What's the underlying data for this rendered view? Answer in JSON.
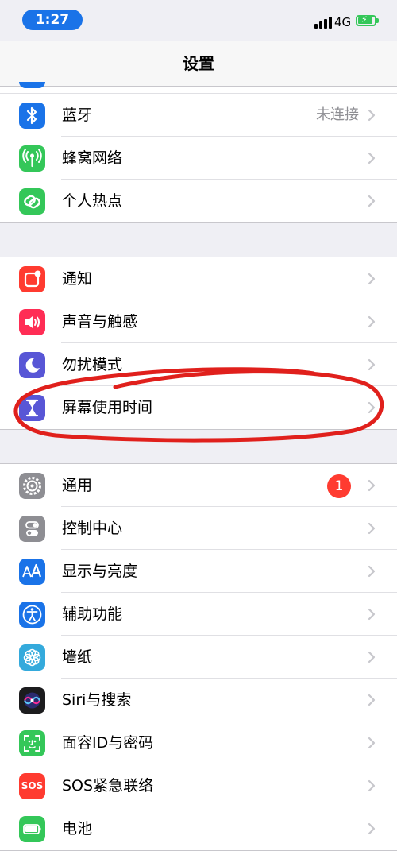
{
  "status_bar": {
    "time": "1:27",
    "network": "4G",
    "signal_bars": 4,
    "battery_charging": true
  },
  "nav": {
    "title": "设置"
  },
  "groups": [
    {
      "rows": [
        {
          "label": "蓝牙",
          "value": "未连接",
          "icon": "bluetooth-icon",
          "color": "#1a73e8"
        },
        {
          "label": "蜂窝网络",
          "icon": "cellular-antenna-icon",
          "color": "#34c759"
        },
        {
          "label": "个人热点",
          "icon": "hotspot-link-icon",
          "color": "#34c759"
        }
      ]
    },
    {
      "rows": [
        {
          "label": "通知",
          "icon": "notification-icon",
          "color": "#ff3b30"
        },
        {
          "label": "声音与触感",
          "icon": "speaker-icon",
          "color": "#ff2d55"
        },
        {
          "label": "勿扰模式",
          "icon": "moon-icon",
          "color": "#5856d6"
        },
        {
          "label": "屏幕使用时间",
          "icon": "hourglass-icon",
          "color": "#5856d6"
        }
      ]
    },
    {
      "rows": [
        {
          "label": "通用",
          "badge": "1",
          "icon": "gear-icon",
          "color": "#8e8e93"
        },
        {
          "label": "控制中心",
          "icon": "toggles-icon",
          "color": "#8e8e93"
        },
        {
          "label": "显示与亮度",
          "icon": "text-size-icon",
          "color": "#1a73e8"
        },
        {
          "label": "辅助功能",
          "icon": "accessibility-icon",
          "color": "#1a73e8"
        },
        {
          "label": "墙纸",
          "icon": "flower-icon",
          "color": "#34aadc"
        },
        {
          "label": "Siri与搜索",
          "icon": "siri-icon",
          "color": "#1c1c1e"
        },
        {
          "label": "面容ID与密码",
          "icon": "face-id-icon",
          "color": "#34c759"
        },
        {
          "label": "SOS紧急联络",
          "icon": "sos-icon",
          "color": "#ff3b30",
          "icon_text": "SOS"
        },
        {
          "label": "电池",
          "icon": "battery-icon",
          "color": "#34c759"
        }
      ]
    }
  ],
  "colors": {
    "annotation_ink": "#e0201c",
    "chevron": "#c7c7cc"
  }
}
